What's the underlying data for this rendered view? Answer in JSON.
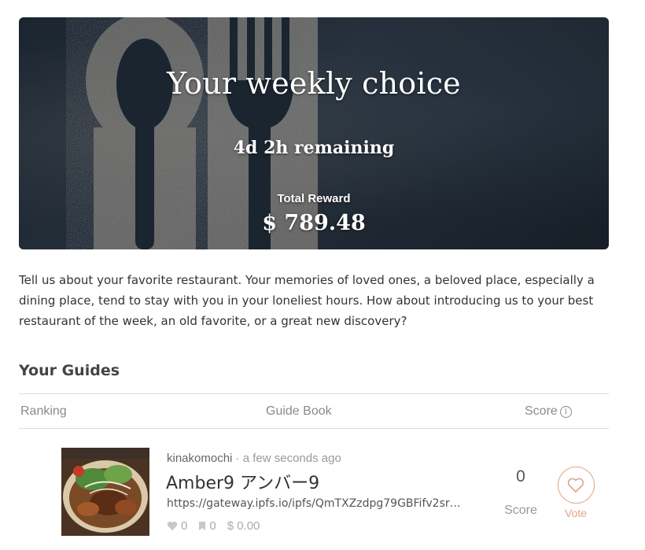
{
  "hero": {
    "title": "Your weekly choice",
    "remaining": "4d 2h remaining",
    "reward_label": "Total Reward",
    "reward_value": "$ 789.48"
  },
  "intro": "Tell us about your favorite restaurant. Your memories of loved ones, a beloved place, especially a dining place, tend to stay with you in your loneliest hours. How about introducing us to your best restaurant of the week, an old favorite, or a great new discovery?",
  "guides": {
    "title": "Your Guides",
    "columns": {
      "ranking": "Ranking",
      "guide_book": "Guide Book",
      "score": "Score"
    },
    "rows": [
      {
        "author": "kinakomochi",
        "separator": " · ",
        "time": "a few seconds ago",
        "title": "Amber9 アンバー9",
        "url": "https://gateway.ipfs.io/ipfs/QmTXZzdpg79GBFifv2sr…",
        "likes": "0",
        "bookmarks": "0",
        "payout": "$ 0.00",
        "score": "0",
        "score_label": "Score",
        "vote_label": "Vote"
      }
    ]
  },
  "colors": {
    "accent": "#e3a487",
    "hero_bg": "#1f2a36"
  },
  "icons": [
    "info-icon",
    "heart-icon",
    "bookmark-icon",
    "dollar-icon",
    "vote-heart-icon"
  ]
}
